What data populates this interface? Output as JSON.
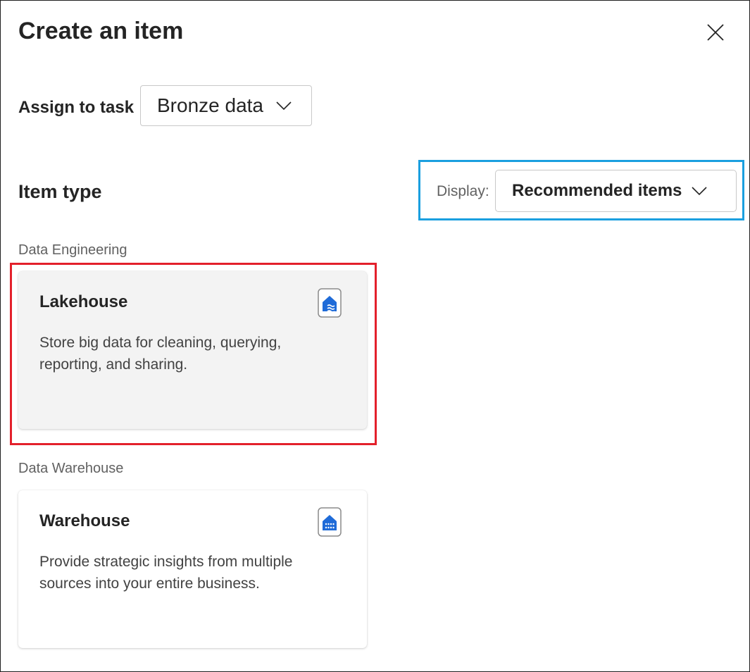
{
  "dialog": {
    "title": "Create an item",
    "close_icon": "close-icon"
  },
  "assign": {
    "label": "Assign to task",
    "selected_value": "Bronze data",
    "dropdown_icon": "chevron-down-icon"
  },
  "item_type": {
    "heading": "Item type",
    "display_label": "Display:",
    "display_value": "Recommended items",
    "dropdown_icon": "chevron-down-icon",
    "highlight_color": "#1a9fdf"
  },
  "sections": [
    {
      "category": "Data Engineering",
      "card": {
        "title": "Lakehouse",
        "description": "Store big data for cleaning, querying, reporting, and sharing.",
        "icon": "lakehouse-icon",
        "selected": true,
        "highlight_color": "#e3202b"
      }
    },
    {
      "category": "Data Warehouse",
      "card": {
        "title": "Warehouse",
        "description": "Provide strategic insights from multiple sources into your entire business.",
        "icon": "warehouse-icon",
        "selected": false
      }
    }
  ],
  "colors": {
    "icon_accent": "#1f6bd8",
    "text_primary": "#242424",
    "text_secondary": "#616161"
  }
}
